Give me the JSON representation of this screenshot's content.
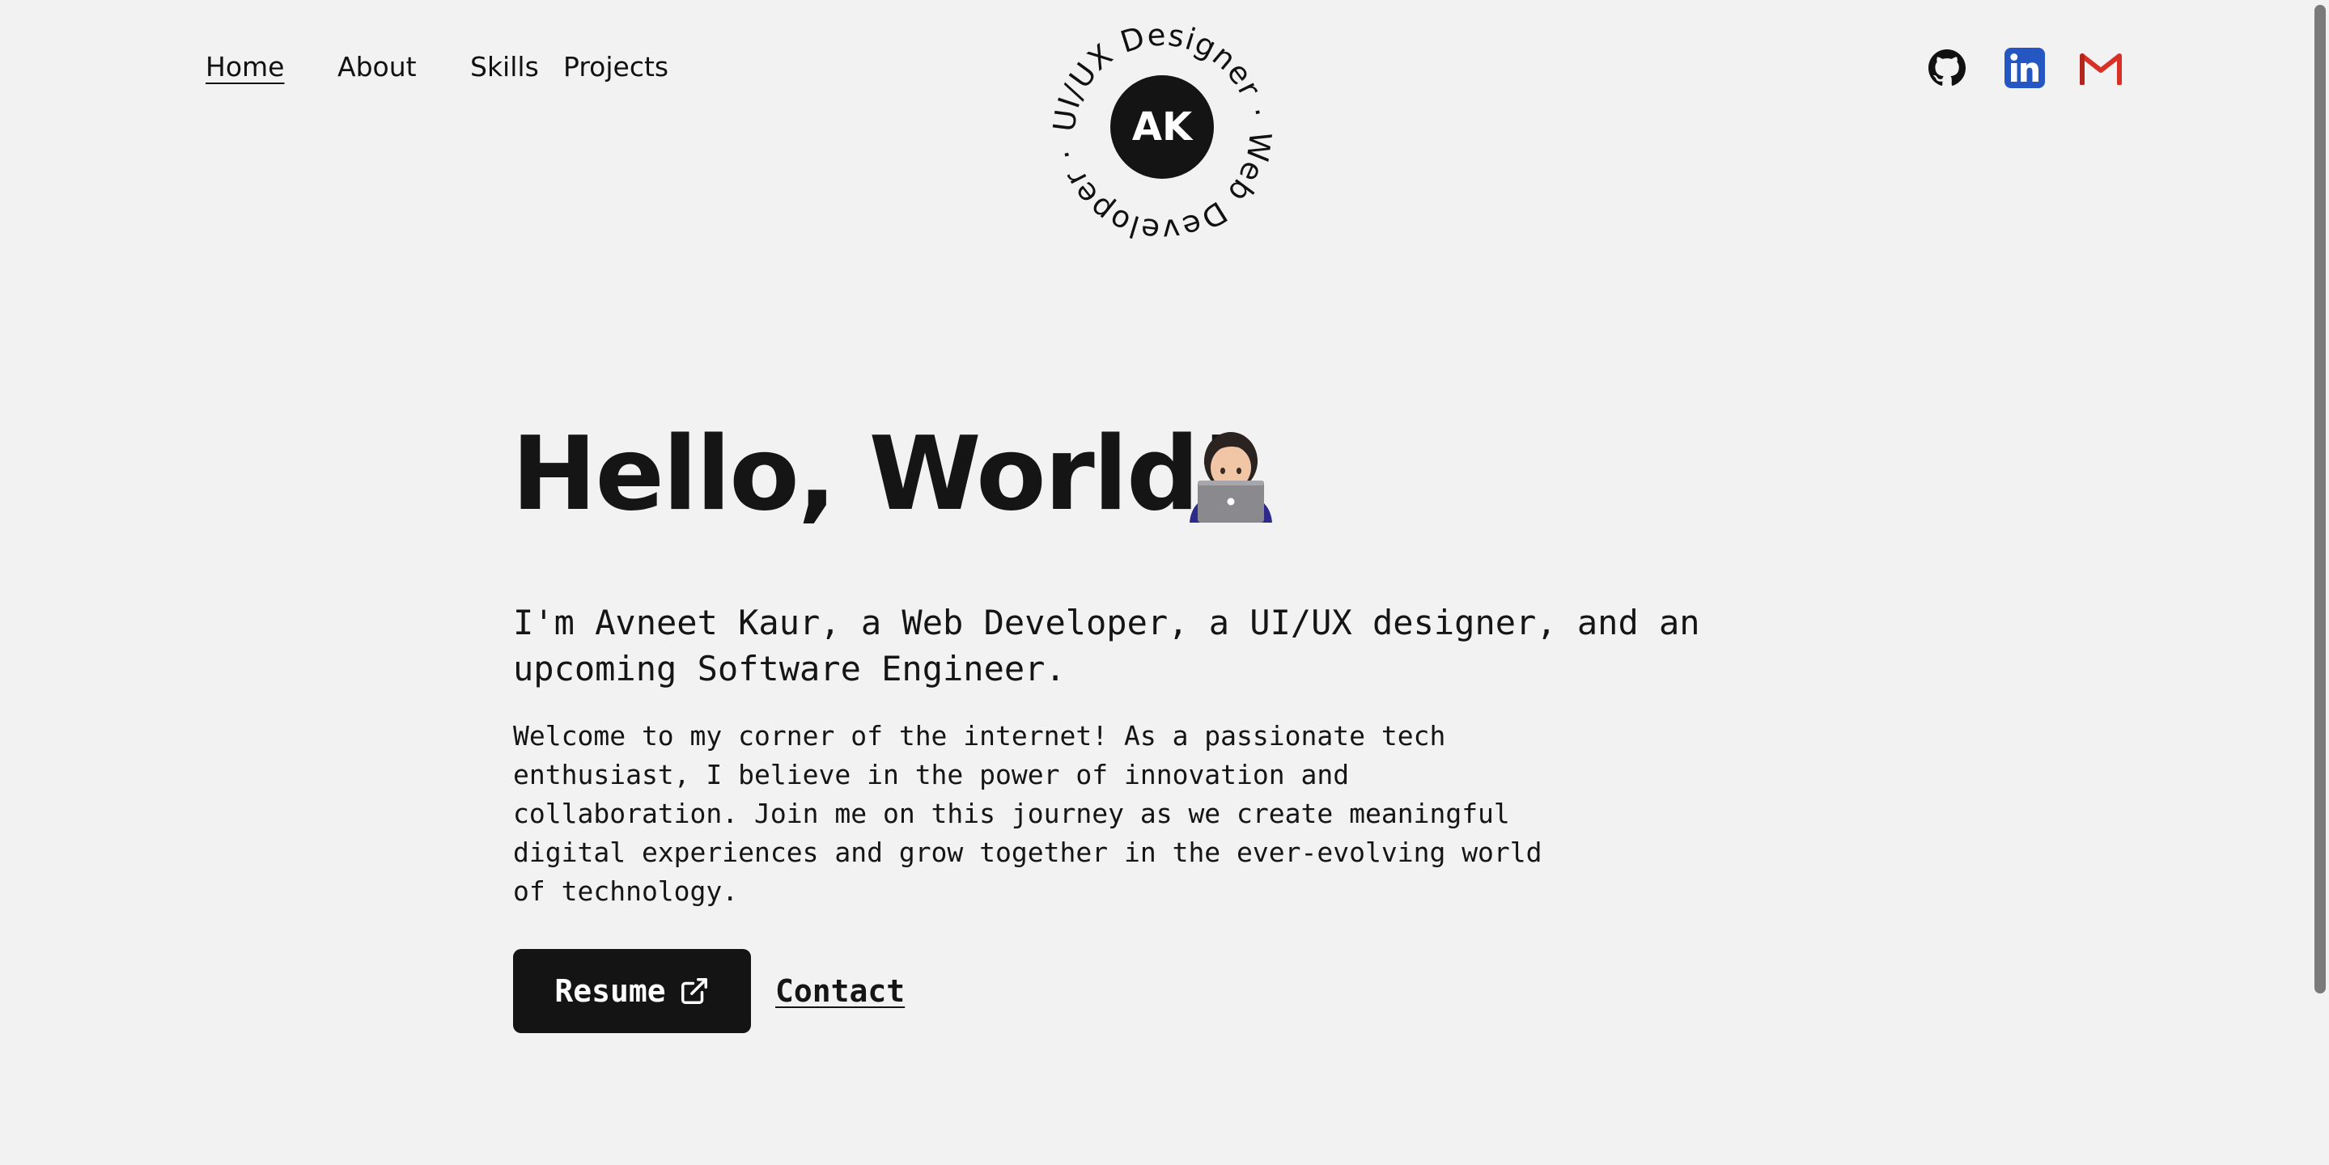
{
  "nav": {
    "items": [
      {
        "label": "Home",
        "active": true
      },
      {
        "label": "About",
        "active": false
      },
      {
        "label": "Skills",
        "active": false
      },
      {
        "label": "Projects",
        "active": false
      }
    ]
  },
  "logo": {
    "initials": "AK",
    "ring_text": "UI/UX Designer · Web Developer · "
  },
  "social": [
    {
      "name": "github",
      "icon": "github-icon",
      "color": "#111111"
    },
    {
      "name": "linkedin",
      "icon": "linkedin-icon",
      "color": "#2557c2"
    },
    {
      "name": "gmail",
      "icon": "gmail-icon",
      "color": "#d93025"
    }
  ],
  "hero": {
    "title": "Hello, World!",
    "emoji_icon": "woman-technologist-icon",
    "lead": "I'm Avneet Kaur, a Web Developer, a UI/UX designer, and an upcoming Software Engineer.",
    "body": "Welcome to my corner of the internet! As a passionate tech enthusiast, I believe in the power of innovation and collaboration. Join me on this journey as we create meaningful digital experiences and grow together in the ever-evolving world of technology.",
    "resume_label": "Resume",
    "resume_icon": "external-link-icon",
    "contact_label": "Contact"
  },
  "colors": {
    "background": "#f2f2f2",
    "text": "#141414",
    "button": "#141414"
  }
}
